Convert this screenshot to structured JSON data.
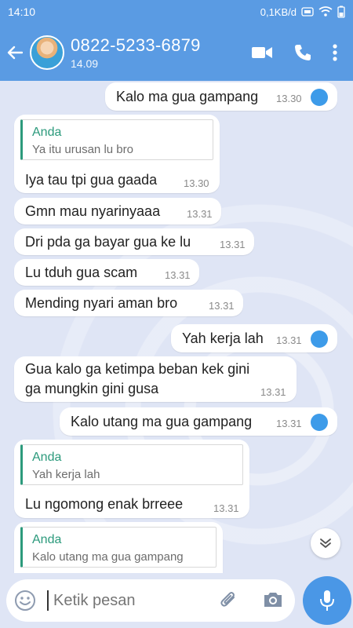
{
  "status_bar": {
    "time": "14:10",
    "net_speed": "0,1KB/d"
  },
  "header": {
    "contact_name": "0822-5233-6879",
    "last_seen": "14.09"
  },
  "messages": [
    {
      "text": "Kalo ma gua gampang",
      "time": "13.30"
    },
    {
      "quote_name": "Anda",
      "quote_text": "Ya itu urusan lu bro",
      "text": "Iya tau tpi gua gaada",
      "time": "13.30"
    },
    {
      "text": "Gmn mau nyarinyaaa",
      "time": "13.31"
    },
    {
      "text": "Dri pda ga bayar gua ke lu",
      "time": "13.31"
    },
    {
      "text": "Lu tduh gua scam",
      "time": "13.31"
    },
    {
      "text": "Mending nyari aman bro",
      "time": "13.31"
    },
    {
      "text": "Yah kerja lah",
      "time": "13.31"
    },
    {
      "text_line1": "Gua kalo ga ketimpa beban kek gini",
      "text_line2": "ga mungkin gini gusa",
      "time": "13.31"
    },
    {
      "text": "Kalo utang ma gua gampang",
      "time": "13.31"
    },
    {
      "quote_name": "Anda",
      "quote_text": "Yah kerja lah",
      "text": "Lu ngomong enak brreee",
      "time": "13.31"
    },
    {
      "quote_name": "Anda",
      "quote_text": "Kalo utang ma gua gampang"
    }
  ],
  "composer": {
    "placeholder": "Ketik pesan"
  },
  "colors": {
    "header": "#5a9be3",
    "accent_green": "#2c9a7c",
    "read_tick": "#3d9be9"
  }
}
